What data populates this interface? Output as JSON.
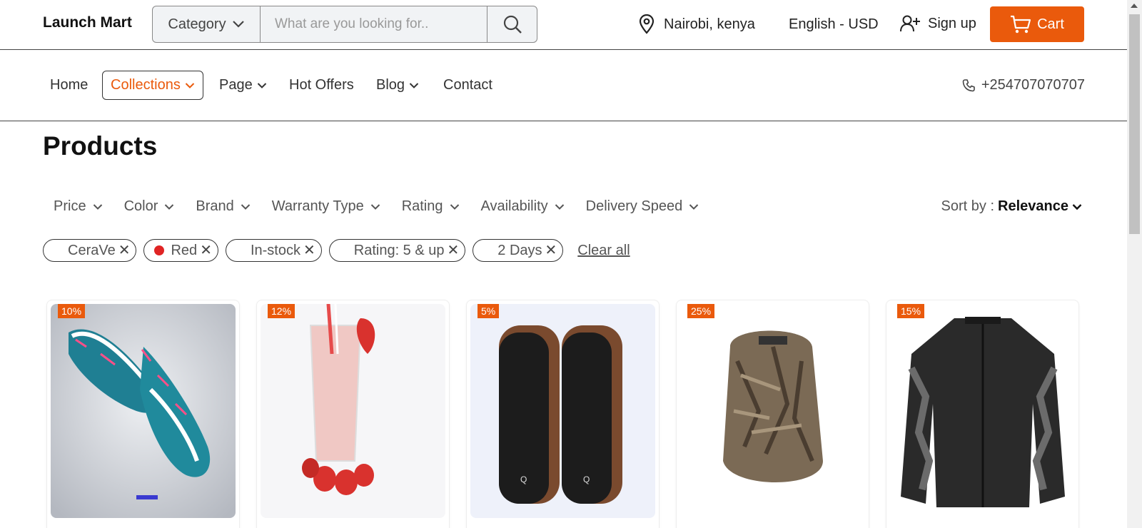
{
  "header": {
    "brand": "Launch Mart",
    "category_label": "Category",
    "search_placeholder": "What are you looking for..",
    "location": "Nairobi, kenya",
    "language_currency": "English - USD",
    "signup_label": "Sign up",
    "cart_label": "Cart"
  },
  "nav": {
    "items": [
      {
        "label": "Home"
      },
      {
        "label": "Collections"
      },
      {
        "label": "Page"
      },
      {
        "label": "Hot Offers"
      },
      {
        "label": "Blog"
      },
      {
        "label": "Contact"
      }
    ],
    "phone": "+254707070707"
  },
  "page_title": "Products",
  "filters": [
    "Price",
    "Color",
    "Brand",
    "Warranty Type",
    "Rating",
    "Availability",
    "Delivery Speed"
  ],
  "sort": {
    "label": "Sort by :",
    "value": "Relevance"
  },
  "chips": [
    "CeraVe",
    "Red",
    "In-stock",
    "Rating: 5 & up",
    "2 Days"
  ],
  "clear_all": "Clear all",
  "products": [
    {
      "discount": "10%"
    },
    {
      "discount": "12%"
    },
    {
      "discount": "5%"
    },
    {
      "discount": "25%"
    },
    {
      "discount": "15%"
    }
  ],
  "colors": {
    "accent": "#ea5a0c",
    "chip_red": "#e02424"
  }
}
